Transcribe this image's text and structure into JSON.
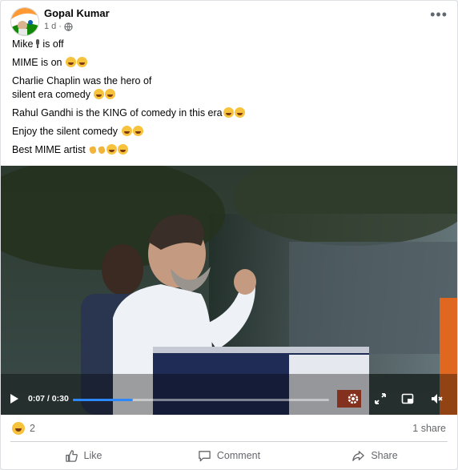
{
  "post": {
    "author": "Gopal Kumar",
    "time": "1 d",
    "separator": "·",
    "audience_icon": "globe-icon",
    "more_icon": "more-dots-icon",
    "more_glyph": "•••",
    "lines": [
      {
        "text": "Mike",
        "tail": "is off",
        "icons": [
          "microphone-icon"
        ]
      },
      {
        "text": "MIME is on",
        "icons": [
          "laughing-emoji",
          "laughing-emoji"
        ]
      },
      {
        "text": "Charlie Chaplin was the hero of",
        "icons": []
      },
      {
        "text": "silent era comedy",
        "icons": [
          "laughing-emoji",
          "laughing-emoji"
        ]
      },
      {
        "text": "Rahul Gandhi is the KING of comedy in this era",
        "icons": [
          "laughing-emoji",
          "laughing-emoji"
        ]
      },
      {
        "text": "Enjoy the silent comedy",
        "icons": [
          "laughing-emoji",
          "laughing-emoji"
        ]
      },
      {
        "text": "Best MIME artist",
        "icons": [
          "ok-hand-emoji",
          "ok-hand-emoji",
          "laughing-emoji",
          "laughing-emoji"
        ]
      }
    ]
  },
  "video": {
    "time_current": "0:07",
    "time_total": "0:30",
    "time_display": "0:07 / 0:30",
    "progress_fraction": 0.233,
    "control_icons": [
      "play-icon",
      "settings-icon",
      "expand-icon",
      "picture-in-picture-icon",
      "mute-icon"
    ]
  },
  "stats": {
    "reaction_icon": "haha-reaction-icon",
    "reaction_count": "2",
    "shares": "1 share"
  },
  "actions": {
    "like": "Like",
    "comment": "Comment",
    "share": "Share"
  },
  "colors": {
    "accent": "#2d88ff",
    "secondary_text": "#65676b",
    "flag_saffron": "#ff9933",
    "flag_green": "#138808"
  }
}
